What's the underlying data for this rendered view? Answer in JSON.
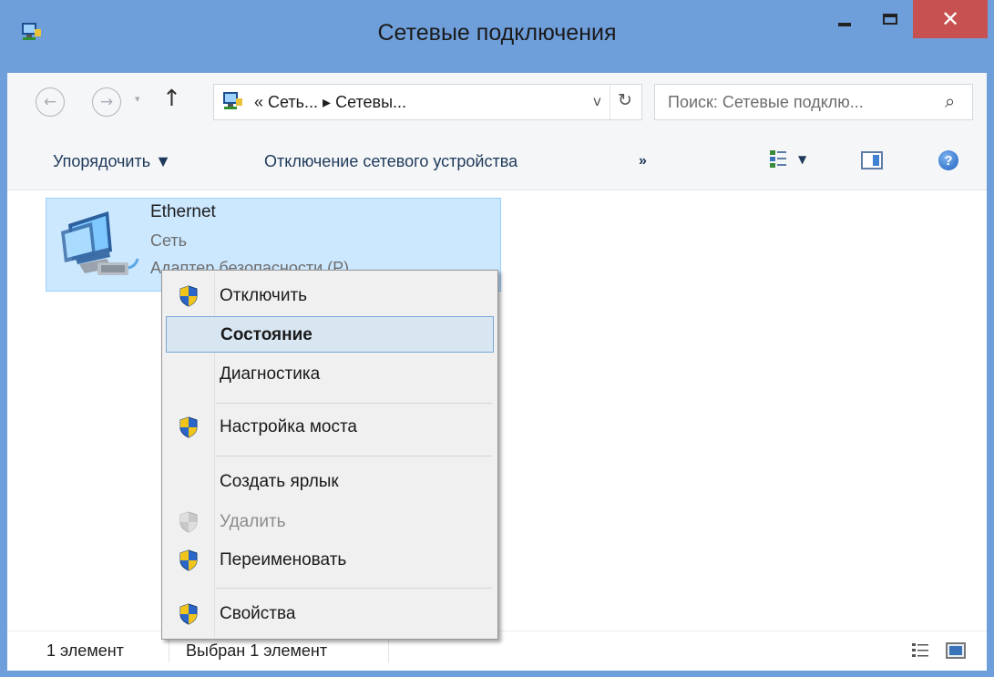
{
  "window": {
    "title": "Сетевые подключения",
    "accent": "#6f9fdb",
    "close_color": "#c75050",
    "close_glyph": "✕"
  },
  "nav": {
    "back_glyph": "←",
    "forward_glyph": "→",
    "history_glyph": "▾",
    "up_glyph": "↑"
  },
  "address": {
    "path": "« Сеть... ▸ Сетевы...",
    "dropdown_glyph": "v",
    "refresh_glyph": "↻"
  },
  "search": {
    "placeholder": "Поиск: Сетевые подклю...",
    "icon_glyph": "⌕"
  },
  "toolbar": {
    "organize_label": "Упорядочить ▼",
    "disable_label": "Отключение сетевого устройства",
    "more_label": "»",
    "view_arrow": "▼",
    "help_glyph": "?"
  },
  "connection": {
    "name": "Ethernet",
    "network": "Сеть",
    "adapter": "Адаптер безопасности (P)"
  },
  "status": {
    "count": "1 элемент",
    "selected": "Выбран 1 элемент"
  },
  "context_menu": {
    "items": [
      {
        "label": "Отключить",
        "icon": "uac-shield-icon"
      },
      {
        "label": "Состояние",
        "state": "highlighted-default"
      },
      {
        "label": "Диагностика"
      },
      {
        "label": "Настройка моста",
        "icon": "uac-shield-icon"
      },
      {
        "label": "Создать ярлык"
      },
      {
        "label": "Удалить",
        "icon": "uac-shield-icon",
        "state": "disabled"
      },
      {
        "label": "Переименовать",
        "icon": "uac-shield-icon"
      },
      {
        "label": "Свойства",
        "icon": "uac-shield-icon"
      }
    ]
  }
}
